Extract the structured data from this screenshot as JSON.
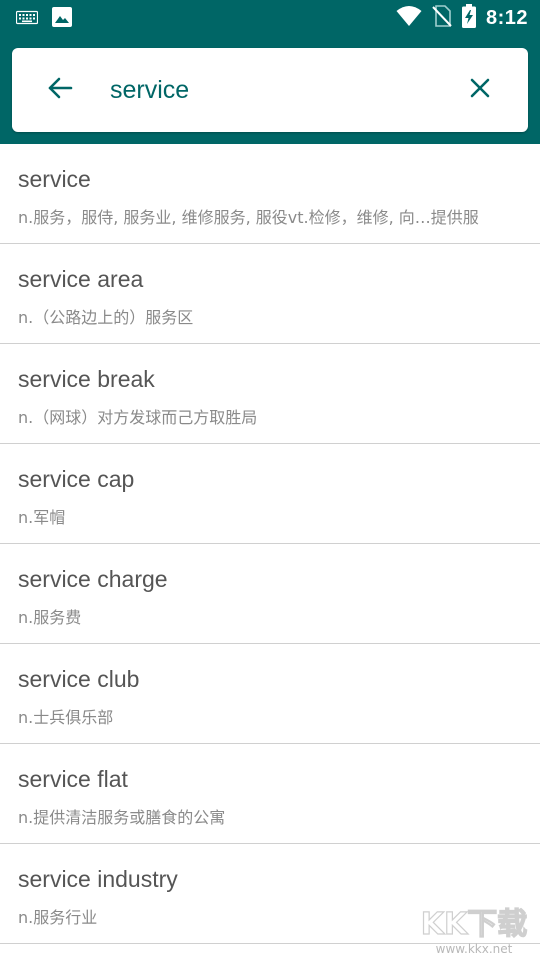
{
  "status_bar": {
    "time": "8:12",
    "left_icons": [
      "keyboard-icon",
      "image-icon"
    ],
    "right_icons": [
      "wifi-icon",
      "no-sim-icon",
      "battery-charging-icon"
    ]
  },
  "search": {
    "query": "service",
    "back_icon": "arrow-left-icon",
    "clear_icon": "close-icon"
  },
  "results": [
    {
      "word": "service",
      "definition": "n.服务，服侍, 服务业, 维修服务, 服役vt.检修，维修, 向…提供服"
    },
    {
      "word": "service area",
      "definition": "n.（公路边上的）服务区"
    },
    {
      "word": "service break",
      "definition": "n.（网球）对方发球而己方取胜局"
    },
    {
      "word": "service cap",
      "definition": "n.军帽"
    },
    {
      "word": "service charge",
      "definition": "n.服务费"
    },
    {
      "word": "service club",
      "definition": "n.士兵俱乐部"
    },
    {
      "word": "service flat",
      "definition": "n.提供清洁服务或膳食的公寓"
    },
    {
      "word": "service industry",
      "definition": "n.服务行业"
    }
  ],
  "watermark": {
    "logo_text": "KK下载",
    "url": "www.kkx.net"
  },
  "colors": {
    "accent": "#006666",
    "word_text": "#555555",
    "definition_text": "#8a8a8a",
    "divider": "#d0d0d0"
  }
}
